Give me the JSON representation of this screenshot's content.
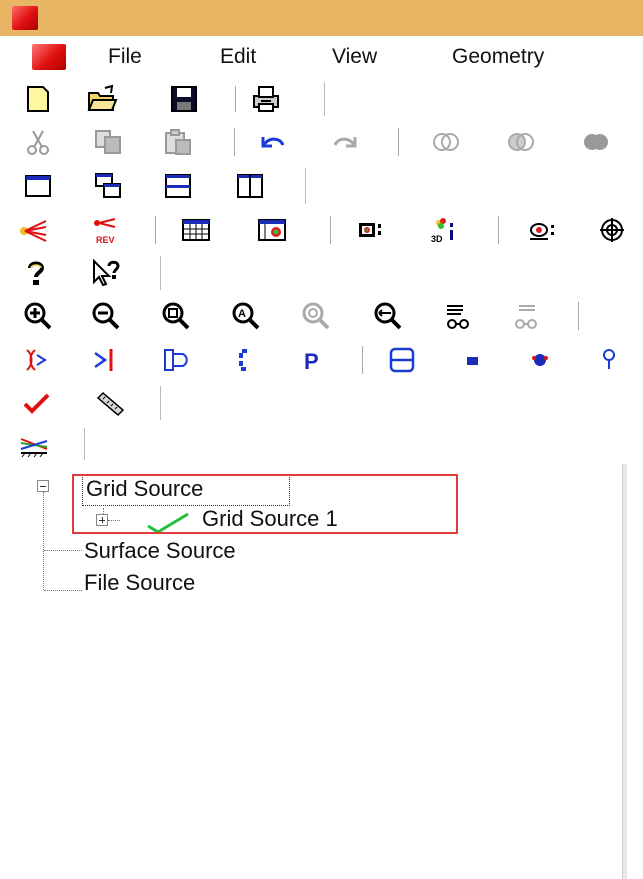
{
  "menubar": {
    "items": [
      {
        "label": "File"
      },
      {
        "label": "Edit"
      },
      {
        "label": "View"
      },
      {
        "label": "Geometry"
      }
    ]
  },
  "tree": {
    "root": {
      "label": "Grid Source"
    },
    "child": {
      "label": "Grid Source 1"
    },
    "items": [
      {
        "label": "Surface Source"
      },
      {
        "label": "File Source"
      }
    ]
  },
  "colors": {
    "titlebar": "#e8b565",
    "selection_outline": "#e53a3a",
    "check": "#22c03a"
  }
}
